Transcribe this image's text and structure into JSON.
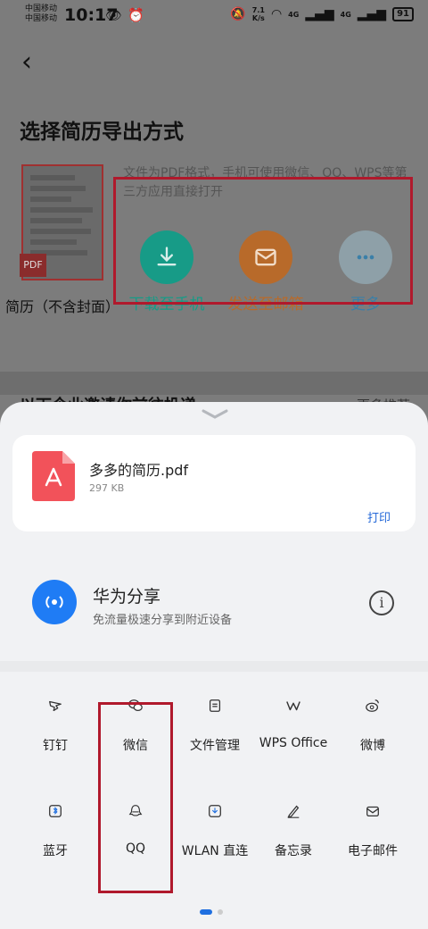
{
  "status_bar": {
    "carrier_1": "中国移动",
    "carrier_2": "中国移动",
    "time": "10:17",
    "net_speed_value": "7.1",
    "net_speed_unit": "K/s",
    "signal_1": "4G",
    "signal_2": "4G",
    "battery": "91"
  },
  "page": {
    "title": "选择简历导出方式",
    "pdf_badge": "PDF",
    "resume_label": "简历（不含封面）",
    "description": "文件为PDF格式，手机可使用微信、QQ、WPS等第三方应用直接打开",
    "actions": [
      {
        "label": "下载至手机",
        "color": "#179b87"
      },
      {
        "label": "发送至邮箱",
        "color": "#b86a2a"
      },
      {
        "label": "更多",
        "color": "#3a7fa8"
      }
    ],
    "section_peek": "以下企业邀请你前往投递",
    "more_peek": "更多推荐"
  },
  "share_sheet": {
    "file": {
      "name": "多多的简历.pdf",
      "size": "297 KB",
      "print_label": "打印"
    },
    "huawei_share": {
      "title": "华为分享",
      "subtitle": "免流量极速分享到附近设备"
    },
    "apps": [
      {
        "label": "钉钉",
        "icon": "dingtalk-icon"
      },
      {
        "label": "微信",
        "icon": "wechat-icon"
      },
      {
        "label": "文件管理",
        "icon": "file-manager-icon"
      },
      {
        "label": "WPS Office",
        "icon": "wps-icon"
      },
      {
        "label": "微博",
        "icon": "weibo-icon"
      },
      {
        "label": "蓝牙",
        "icon": "bluetooth-icon"
      },
      {
        "label": "QQ",
        "icon": "qq-icon"
      },
      {
        "label": "WLAN 直连",
        "icon": "wlan-direct-icon"
      },
      {
        "label": "备忘录",
        "icon": "notes-icon"
      },
      {
        "label": "电子邮件",
        "icon": "email-icon"
      }
    ],
    "page_indicator": {
      "current": 1,
      "total": 2
    }
  },
  "colors": {
    "accent_blue": "#1f6fe0",
    "highlight_red": "#b0192c"
  }
}
